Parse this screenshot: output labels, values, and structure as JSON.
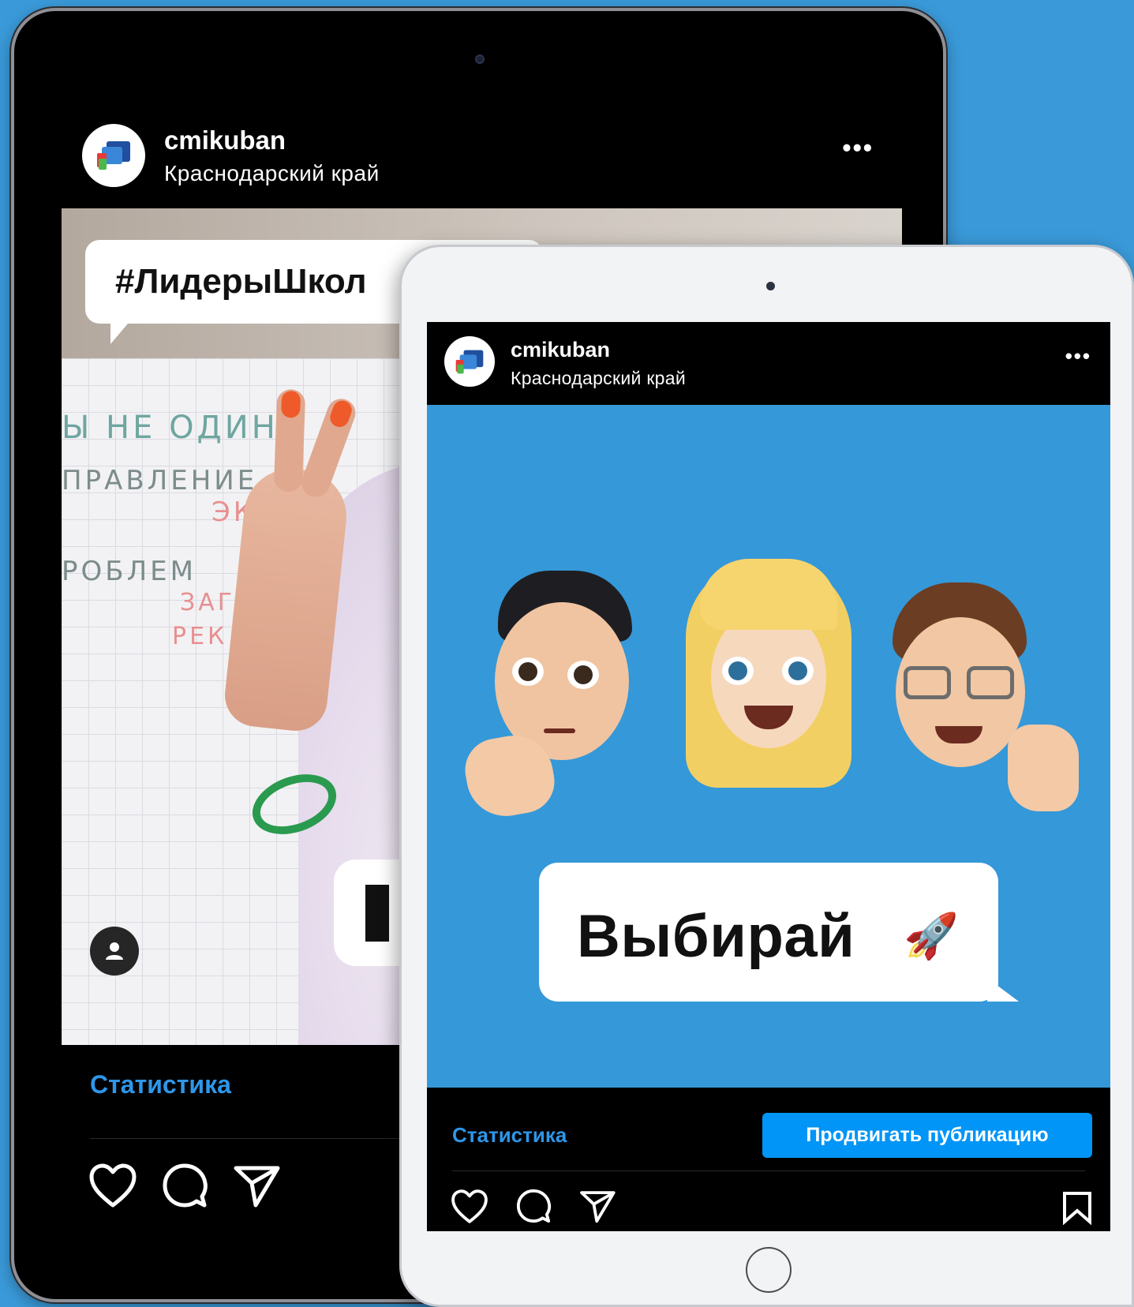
{
  "back_post": {
    "handle": "cmikuban",
    "location": "Краснодарский край",
    "more_label": "•••",
    "hashtag": "#ЛидерыШкол",
    "board_lines": [
      "Ы НЕ ОДИН!",
      "ПРАВЛЕНИЕ",
      "ЭКОЛ",
      "РОБЛЕМ",
      "ЗАГР",
      "РЕК"
    ],
    "stats_label": "Статистика"
  },
  "front_post": {
    "handle": "cmikuban",
    "location": "Краснодарский край",
    "more_label": "•••",
    "bubble_text": "Выбирай",
    "bubble_emoji": "🚀",
    "stats_label": "Статистика",
    "promote_label": "Продвигать публикацию"
  },
  "icons": [
    "like-icon",
    "comment-icon",
    "share-icon",
    "save-icon",
    "user-tag-icon",
    "brand-logo-icon"
  ],
  "colors": {
    "background": "#3a9ad9",
    "post_background": "#3598d8",
    "link_blue": "#2e96e8",
    "promote_button": "#0095f6",
    "nail_orange": "#ef5a2a",
    "bracelet_green": "#2a9a4f"
  }
}
